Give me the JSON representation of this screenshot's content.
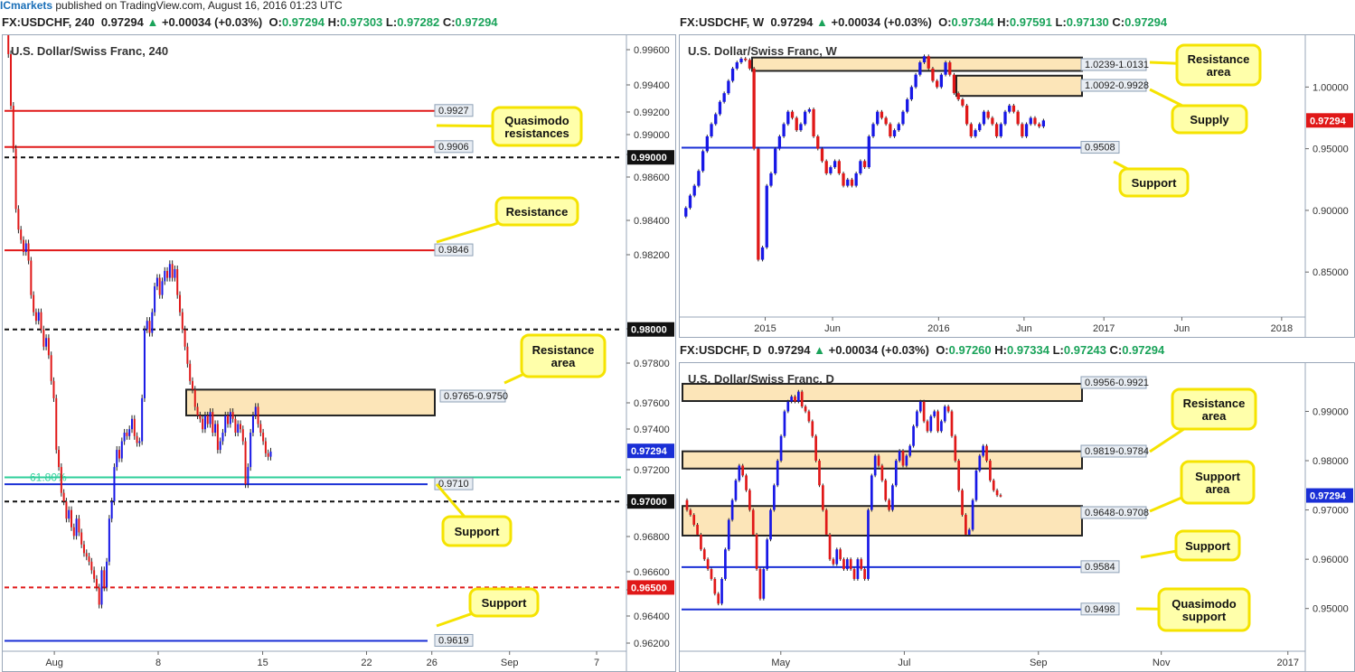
{
  "header": {
    "brand": "ICmarkets",
    "text": " published on TradingView.com, August 16, 2016 01:23 UTC"
  },
  "colors": {
    "bull": "#1717e6",
    "bear": "#e01818",
    "zone_fill": "#fce5b8",
    "zone_stroke": "#222222",
    "red_line": "#e01818",
    "blue_line": "#1a2fd6",
    "fib": "#2ecf9a",
    "callout_fill": "#ffffaa",
    "callout_stroke": "#f5e300"
  },
  "panels": [
    {
      "id": "h4",
      "head": {
        "symbol": "FX:USDCHF, 240",
        "price": "0.97294",
        "change": "+0.00034 (+0.03%)",
        "o": "0.97294",
        "h": "0.97303",
        "l": "0.97282",
        "c": "0.97294"
      },
      "title": "U.S. Dollar/Swiss Franc, 240",
      "price_tag": "0.97294"
    },
    {
      "id": "weekly",
      "head": {
        "symbol": "FX:USDCHF, W",
        "price": "0.97294",
        "change": "+0.00034 (+0.03%)",
        "o": "0.97344",
        "h": "0.97591",
        "l": "0.97130",
        "c": "0.97294"
      },
      "title": "U.S. Dollar/Swiss Franc, W",
      "price_tag": "0.97294"
    },
    {
      "id": "daily",
      "head": {
        "symbol": "FX:USDCHF, D",
        "price": "0.97294",
        "change": "+0.00034 (+0.03%)",
        "o": "0.97260",
        "h": "0.97334",
        "l": "0.97243",
        "c": "0.97294"
      },
      "title": "U.S. Dollar/Swiss Franc, D",
      "price_tag": "0.97294"
    }
  ],
  "chart_data": [
    {
      "id": "h4",
      "type": "candlestick",
      "title": "U.S. Dollar/Swiss Franc, 240",
      "x_ticks": [
        "Aug",
        "8",
        "15",
        "22",
        "26",
        "Sep",
        "7"
      ],
      "y_ticks": [
        "0.99600",
        "0.99400",
        "0.99200",
        "0.99000",
        "0.98800",
        "0.98600",
        "0.98400",
        "0.98200",
        "0.98000",
        "0.97800",
        "0.97600",
        "0.97400",
        "0.97200",
        "0.97000",
        "0.96800",
        "0.96600",
        "0.96500",
        "0.96400",
        "0.96200"
      ],
      "ylim": [
        0.9614,
        0.9971
      ],
      "series_close": [
        0.998,
        0.996,
        0.993,
        0.9905,
        0.987,
        0.9858,
        0.9852,
        0.9845,
        0.985,
        0.984,
        0.982,
        0.981,
        0.9805,
        0.981,
        0.98,
        0.979,
        0.9795,
        0.9785,
        0.977,
        0.976,
        0.973,
        0.972,
        0.9705,
        0.97,
        0.969,
        0.9695,
        0.9685,
        0.968,
        0.969,
        0.9682,
        0.9675,
        0.967,
        0.9668,
        0.9665,
        0.966,
        0.9655,
        0.965,
        0.964,
        0.966,
        0.965,
        0.9665,
        0.969,
        0.97,
        0.972,
        0.973,
        0.9725,
        0.9735,
        0.974,
        0.9738,
        0.9742,
        0.9748,
        0.9738,
        0.9734,
        0.9735,
        0.976,
        0.98,
        0.9805,
        0.9798,
        0.981,
        0.9825,
        0.983,
        0.982,
        0.9828,
        0.9834,
        0.983,
        0.9838,
        0.983,
        0.9835,
        0.982,
        0.981,
        0.98,
        0.979,
        0.978,
        0.977,
        0.9765,
        0.9755,
        0.975,
        0.9748,
        0.9742,
        0.975,
        0.9745,
        0.9752,
        0.974,
        0.9745,
        0.973,
        0.9735,
        0.974,
        0.975,
        0.9745,
        0.9752,
        0.9748,
        0.974,
        0.9745,
        0.9742,
        0.9735,
        0.971,
        0.972,
        0.974,
        0.975,
        0.9755,
        0.9745,
        0.974,
        0.9735,
        0.9728,
        0.9726,
        0.9729
      ],
      "levels": [
        {
          "label": "0.9927",
          "value": 0.9927,
          "style": "red"
        },
        {
          "label": "0.9906",
          "value": 0.9906,
          "style": "red"
        },
        {
          "label": "0.99000",
          "value": 0.99,
          "style": "black-dashed"
        },
        {
          "label": "0.9846",
          "value": 0.9846,
          "style": "red"
        },
        {
          "label": "0.98000",
          "value": 0.98,
          "style": "black-dashed"
        },
        {
          "label": "61.80%",
          "value": 0.9714,
          "style": "fib"
        },
        {
          "label": "0.9710",
          "value": 0.971,
          "style": "blue"
        },
        {
          "label": "0.97000",
          "value": 0.97,
          "style": "black-dashed"
        },
        {
          "label": "0.96500",
          "value": 0.965,
          "style": "red-dashed"
        },
        {
          "label": "0.9619",
          "value": 0.9619,
          "style": "blue"
        }
      ],
      "zones": [
        {
          "label": "0.9765-0.9750",
          "top": 0.9765,
          "bottom": 0.975
        }
      ],
      "callouts": [
        "Quasimodo resistances",
        "Resistance",
        "Resistance area",
        "Support",
        "Support"
      ]
    },
    {
      "id": "weekly",
      "type": "candlestick",
      "title": "U.S. Dollar/Swiss Franc, W",
      "x_ticks": [
        "2015",
        "Jun",
        "2016",
        "Jun",
        "2017",
        "Jun",
        "2018"
      ],
      "y_ticks": [
        "1.00000",
        "0.95000",
        "0.90000",
        "0.85000"
      ],
      "ylim": [
        0.815,
        1.042
      ],
      "series_close": [
        0.895,
        0.902,
        0.912,
        0.92,
        0.932,
        0.948,
        0.96,
        0.97,
        0.978,
        0.988,
        0.995,
        1.005,
        1.015,
        1.02,
        1.023,
        1.022,
        1.015,
        0.95,
        0.86,
        0.87,
        0.92,
        0.93,
        0.95,
        0.96,
        0.97,
        0.98,
        0.975,
        0.965,
        0.97,
        0.98,
        0.982,
        0.96,
        0.95,
        0.94,
        0.93,
        0.935,
        0.94,
        0.93,
        0.92,
        0.925,
        0.92,
        0.93,
        0.94,
        0.935,
        0.96,
        0.97,
        0.98,
        0.975,
        0.97,
        0.96,
        0.965,
        0.97,
        0.98,
        0.99,
        1.0,
        1.01,
        1.02,
        1.025,
        1.015,
        1.005,
        1.0,
        1.01,
        1.02,
        1.01,
        0.995,
        0.99,
        0.985,
        0.97,
        0.96,
        0.965,
        0.97,
        0.98,
        0.975,
        0.97,
        0.96,
        0.97,
        0.98,
        0.985,
        0.98,
        0.97,
        0.96,
        0.97,
        0.975,
        0.97,
        0.968,
        0.9729
      ],
      "levels": [
        {
          "label": "0.9508",
          "value": 0.9508,
          "style": "blue"
        }
      ],
      "zones": [
        {
          "label": "1.0239-1.0131",
          "top": 1.0239,
          "bottom": 1.0131
        },
        {
          "label": "1.0092-0.9928",
          "top": 1.0092,
          "bottom": 0.9928
        }
      ],
      "callouts": [
        "Resistance area",
        "Supply",
        "Support"
      ]
    },
    {
      "id": "daily",
      "type": "candlestick",
      "title": "U.S. Dollar/Swiss Franc, D",
      "x_ticks": [
        "May",
        "Jul",
        "Sep",
        "Nov",
        "2017"
      ],
      "y_ticks": [
        "0.99000",
        "0.98000",
        "0.97000",
        "0.96000",
        "0.95000"
      ],
      "ylim": [
        0.9417,
        0.9998
      ],
      "series_close": [
        0.972,
        0.97,
        0.969,
        0.967,
        0.965,
        0.962,
        0.96,
        0.958,
        0.956,
        0.953,
        0.951,
        0.956,
        0.962,
        0.968,
        0.972,
        0.976,
        0.979,
        0.977,
        0.974,
        0.97,
        0.965,
        0.958,
        0.952,
        0.958,
        0.964,
        0.97,
        0.975,
        0.98,
        0.985,
        0.99,
        0.992,
        0.993,
        0.992,
        0.994,
        0.991,
        0.99,
        0.988,
        0.985,
        0.98,
        0.975,
        0.97,
        0.965,
        0.96,
        0.959,
        0.962,
        0.96,
        0.958,
        0.96,
        0.958,
        0.956,
        0.96,
        0.958,
        0.956,
        0.97,
        0.977,
        0.981,
        0.979,
        0.976,
        0.972,
        0.97,
        0.975,
        0.98,
        0.982,
        0.979,
        0.981,
        0.983,
        0.987,
        0.99,
        0.992,
        0.988,
        0.986,
        0.989,
        0.99,
        0.986,
        0.988,
        0.991,
        0.99,
        0.985,
        0.98,
        0.974,
        0.969,
        0.965,
        0.966,
        0.972,
        0.978,
        0.981,
        0.983,
        0.98,
        0.976,
        0.974,
        0.973,
        0.9729
      ],
      "levels": [
        {
          "label": "0.9584",
          "value": 0.9584,
          "style": "blue"
        },
        {
          "label": "0.9498",
          "value": 0.9498,
          "style": "blue"
        }
      ],
      "zones": [
        {
          "label": "0.9956-0.9921",
          "top": 0.9956,
          "bottom": 0.9921
        },
        {
          "label": "0.9819-0.9784",
          "top": 0.9819,
          "bottom": 0.9784
        },
        {
          "label": "0.9648-0.9708",
          "top": 0.9708,
          "bottom": 0.9648
        }
      ],
      "callouts": [
        "Resistance area",
        "Support area",
        "Support",
        "Quasimodo support"
      ]
    }
  ]
}
